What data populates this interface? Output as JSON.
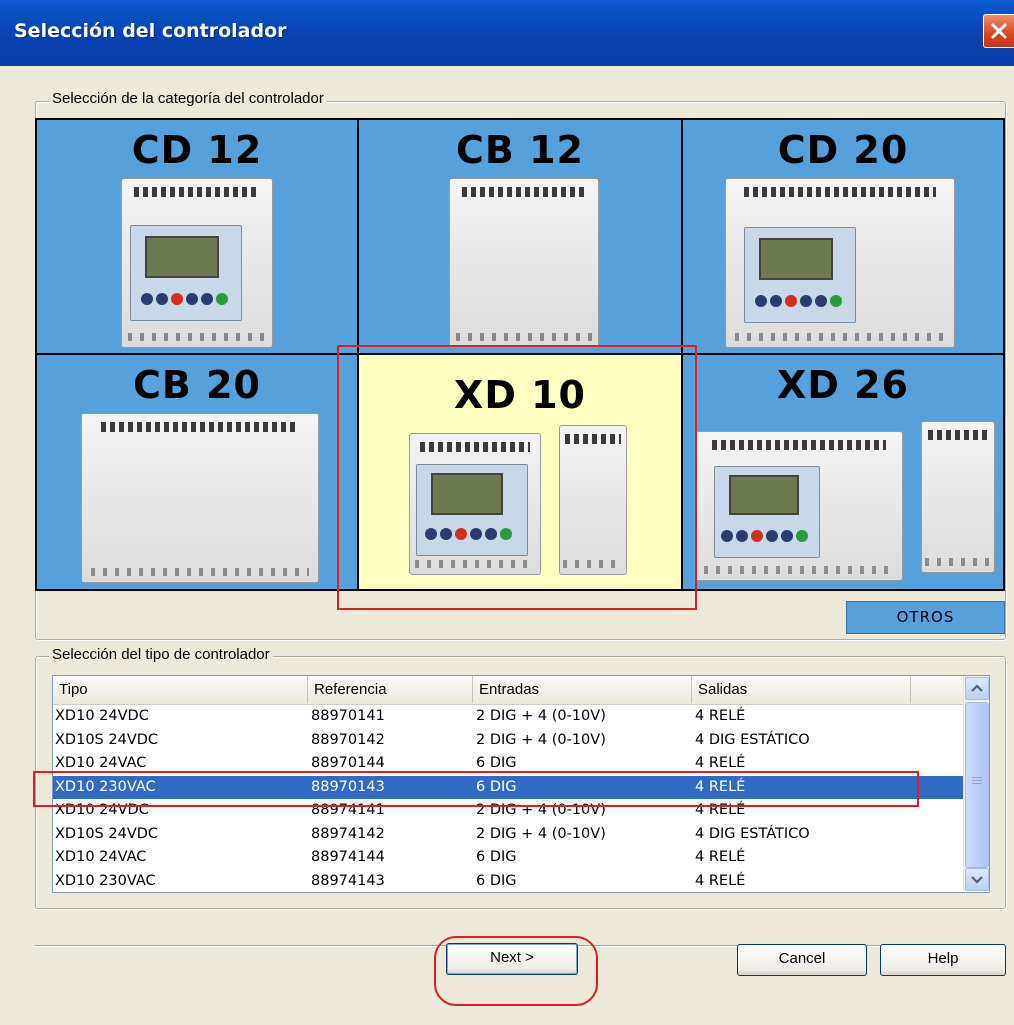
{
  "window": {
    "title": "Selección del controlador",
    "close_icon": "close-icon"
  },
  "category_group": {
    "legend": "Selección de la categoría del controlador",
    "categories": [
      {
        "label": "CD 12",
        "selected": false
      },
      {
        "label": "CB 12",
        "selected": false
      },
      {
        "label": "CD 20",
        "selected": false
      },
      {
        "label": "CB 20",
        "selected": false
      },
      {
        "label": "XD 10",
        "selected": true
      },
      {
        "label": "XD 26",
        "selected": false
      }
    ],
    "tile_color": "#56a0dc",
    "selected_tile_color": "#ffffc2",
    "otros_label": "OTROS"
  },
  "type_group": {
    "legend": "Selección del tipo de controlador",
    "columns": [
      "Tipo",
      "Referencia",
      "Entradas",
      "Salidas"
    ],
    "rows": [
      {
        "tipo": "XD10  24VDC",
        "ref": "88970141",
        "entradas": "2 DIG + 4 (0-10V)",
        "salidas": "4 RELÉ"
      },
      {
        "tipo": "XD10S 24VDC",
        "ref": "88970142",
        "entradas": "2 DIG + 4 (0-10V)",
        "salidas": "4 DIG ESTÁTICO"
      },
      {
        "tipo": "XD10  24VAC",
        "ref": "88970144",
        "entradas": "6 DIG",
        "salidas": "4 RELÉ"
      },
      {
        "tipo": "XD10 230VAC",
        "ref": "88970143",
        "entradas": "6 DIG",
        "salidas": "4 RELÉ"
      },
      {
        "tipo": "XD10  24VDC",
        "ref": "88974141",
        "entradas": "2 DIG + 4 (0-10V)",
        "salidas": "4 RELÉ"
      },
      {
        "tipo": "XD10S 24VDC",
        "ref": "88974142",
        "entradas": "2 DIG + 4 (0-10V)",
        "salidas": "4 DIG ESTÁTICO"
      },
      {
        "tipo": "XD10  24VAC",
        "ref": "88974144",
        "entradas": "6 DIG",
        "salidas": "4 RELÉ"
      },
      {
        "tipo": "XD10 230VAC",
        "ref": "88974143",
        "entradas": "6 DIG",
        "salidas": "4 RELÉ"
      }
    ],
    "selected_row": 3,
    "selection_color": "#316ac5"
  },
  "buttons": {
    "next": "Next >",
    "cancel": "Cancel",
    "help": "Help"
  },
  "annotation_color": "#e01e1e"
}
